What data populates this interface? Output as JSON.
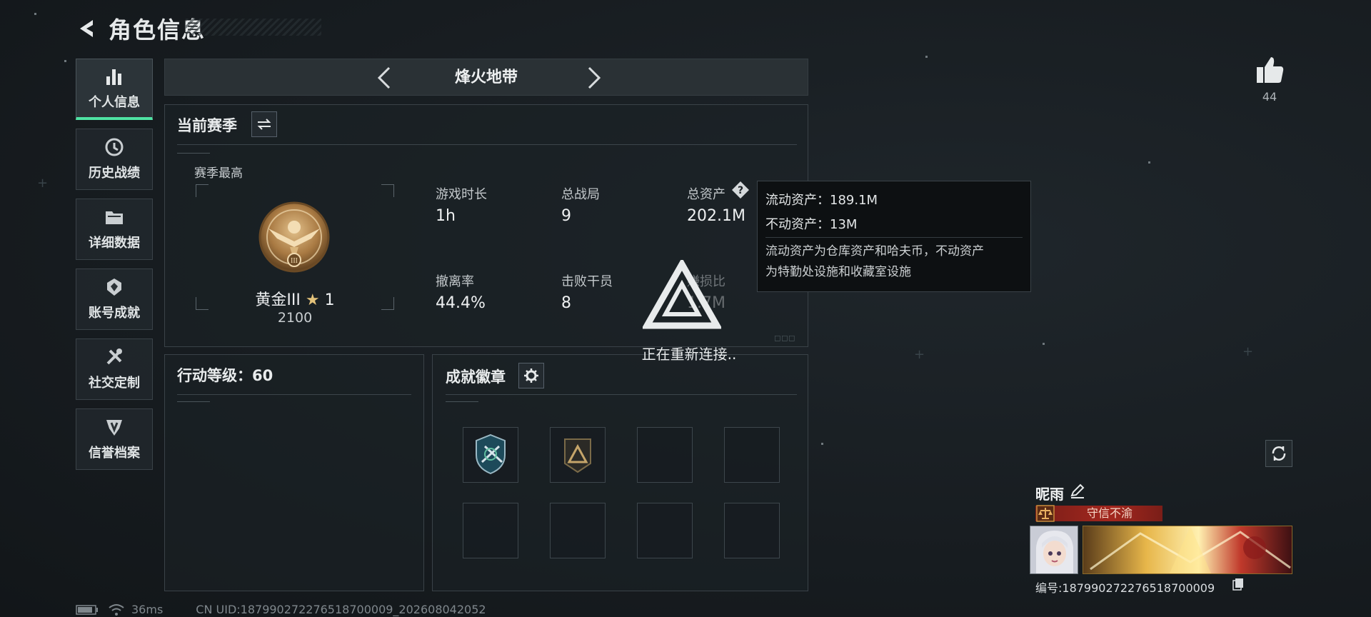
{
  "header": {
    "title": "角色信息"
  },
  "sidebar": {
    "items": [
      {
        "label": "个人信息",
        "icon": "bar-chart-icon",
        "active": true
      },
      {
        "label": "历史战绩",
        "icon": "clock-icon",
        "active": false
      },
      {
        "label": "详细数据",
        "icon": "folder-icon",
        "active": false
      },
      {
        "label": "账号成就",
        "icon": "achievement-icon",
        "active": false
      },
      {
        "label": "社交定制",
        "icon": "tools-icon",
        "active": false
      },
      {
        "label": "信誉档案",
        "icon": "shield-icon",
        "active": false
      }
    ]
  },
  "mode": {
    "title": "烽火地带"
  },
  "season": {
    "label": "当前赛季",
    "best_label": "赛季最高",
    "rank_name": "黄金III",
    "rank_stars": "1",
    "rank_score": "2100",
    "stats": [
      {
        "label": "游戏时长",
        "value": "1h"
      },
      {
        "label": "总战局",
        "value": "9"
      },
      {
        "label": "总资产",
        "value": "202.1M"
      },
      {
        "label": "撤离率",
        "value": "44.4%"
      },
      {
        "label": "击败干员",
        "value": "8"
      },
      {
        "label": "赚损比",
        "value": "1.7M"
      }
    ]
  },
  "tooltip": {
    "liquid": "流动资产：189.1M",
    "fixed": "不动资产：13M",
    "note_line1": "流动资产为仓库资产和哈夫币，不动资产",
    "note_line2": "为特勤处设施和收藏室设施"
  },
  "reconnect": {
    "text": "正在重新连接.."
  },
  "level": {
    "label": "行动等级：60"
  },
  "badges": {
    "label": "成就徽章"
  },
  "likes": {
    "count": "44"
  },
  "player": {
    "nickname": "昵雨",
    "title": "守信不渝",
    "id_text": "编号:187990272276518700009"
  },
  "status": {
    "ping": "36ms",
    "uid": "CN UID:187990272276518700009_202608042052"
  },
  "colors": {
    "accent": "#4fe3a4",
    "title_red": "#a3271e",
    "background": "#171c20"
  }
}
